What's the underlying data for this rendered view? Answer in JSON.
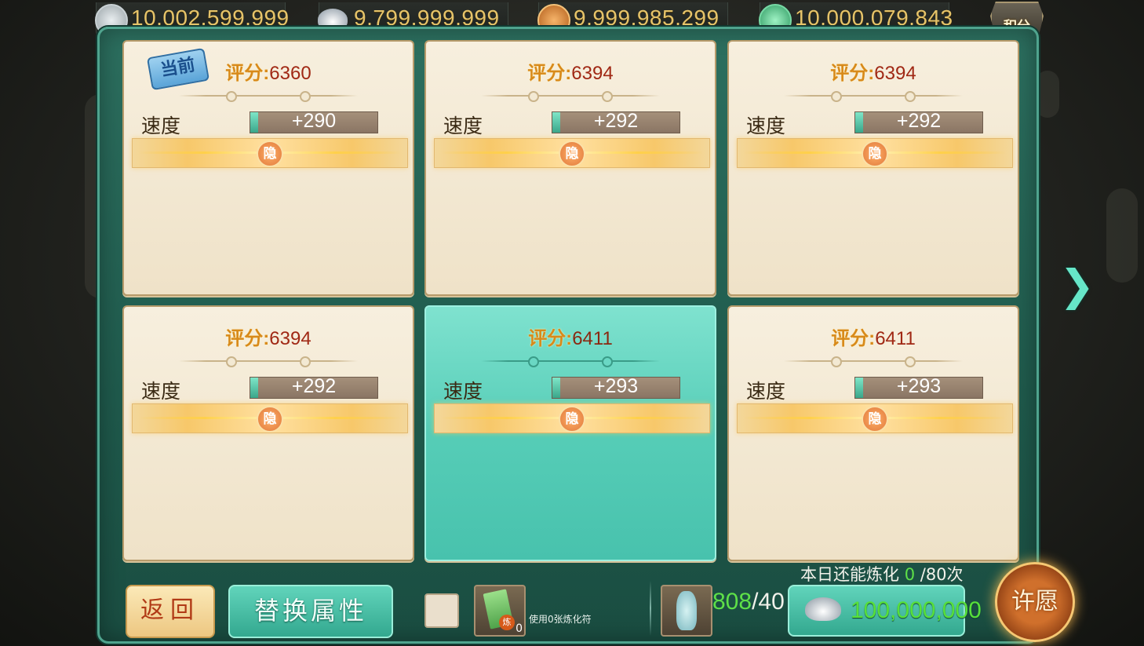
{
  "currencies": [
    {
      "icon": "silver-coin-icon",
      "value": "10,002,599,999"
    },
    {
      "icon": "silver-ingot-icon",
      "value": "9,799,999,999"
    },
    {
      "icon": "copper-coin-icon",
      "value": "9,999,985,299"
    },
    {
      "icon": "jade-add-icon",
      "value": "10,000,079,843"
    }
  ],
  "score_badge_label": "积分",
  "score_label": "评分:",
  "current_tag": "当前",
  "hidden_badge": "隐",
  "cards": [
    {
      "score": "6360",
      "stat_name": "速度",
      "stat_value": "+290",
      "current": true,
      "selected": false
    },
    {
      "score": "6394",
      "stat_name": "速度",
      "stat_value": "+292",
      "current": false,
      "selected": false
    },
    {
      "score": "6394",
      "stat_name": "速度",
      "stat_value": "+292",
      "current": false,
      "selected": false
    },
    {
      "score": "6394",
      "stat_name": "速度",
      "stat_value": "+292",
      "current": false,
      "selected": false
    },
    {
      "score": "6411",
      "stat_name": "速度",
      "stat_value": "+293",
      "current": false,
      "selected": true
    },
    {
      "score": "6411",
      "stat_name": "速度",
      "stat_value": "+293",
      "current": false,
      "selected": false
    }
  ],
  "bottom": {
    "back_label": "返回",
    "replace_label": "替换属性",
    "talisman_count": "0",
    "talisman_seal": "炼",
    "use_talisman_text": "使用0张炼化符",
    "vase_have": "808",
    "vase_need": "/40",
    "daily_prefix": "本日还能炼化 ",
    "daily_remaining": "0",
    "daily_suffix": " /80次",
    "cost_amount": "100,000,000",
    "wish_label": "许愿"
  },
  "colors": {
    "panel": "#1f5a4c",
    "accent": "#5ee048",
    "card": "#f3e9d3",
    "selected_card": "#56cdb7"
  }
}
